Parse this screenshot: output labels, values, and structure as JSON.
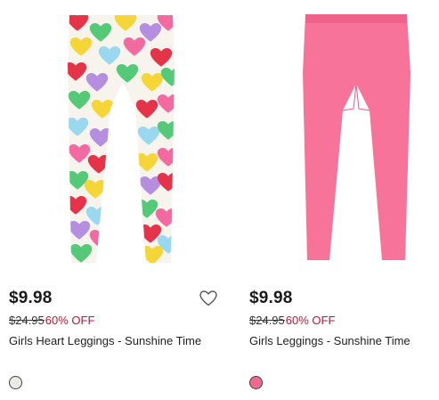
{
  "products": [
    {
      "price": "$9.98",
      "original_price": "$24.95",
      "discount": "60% OFF",
      "name": "Girls Heart Leggings - Sunshine Time",
      "swatch_color": "#eceae4",
      "favorite_icon": "heart-outline-icon",
      "image": "heart-print-leggings"
    },
    {
      "price": "$9.98",
      "original_price": "$24.95",
      "discount": "60% OFF",
      "name": "Girls Leggings - Sunshine Time",
      "swatch_color": "#f06a8e",
      "image": "pink-leggings"
    }
  ],
  "colors": {
    "discount": "#c41230",
    "pink_leggings": "#f7739a"
  }
}
